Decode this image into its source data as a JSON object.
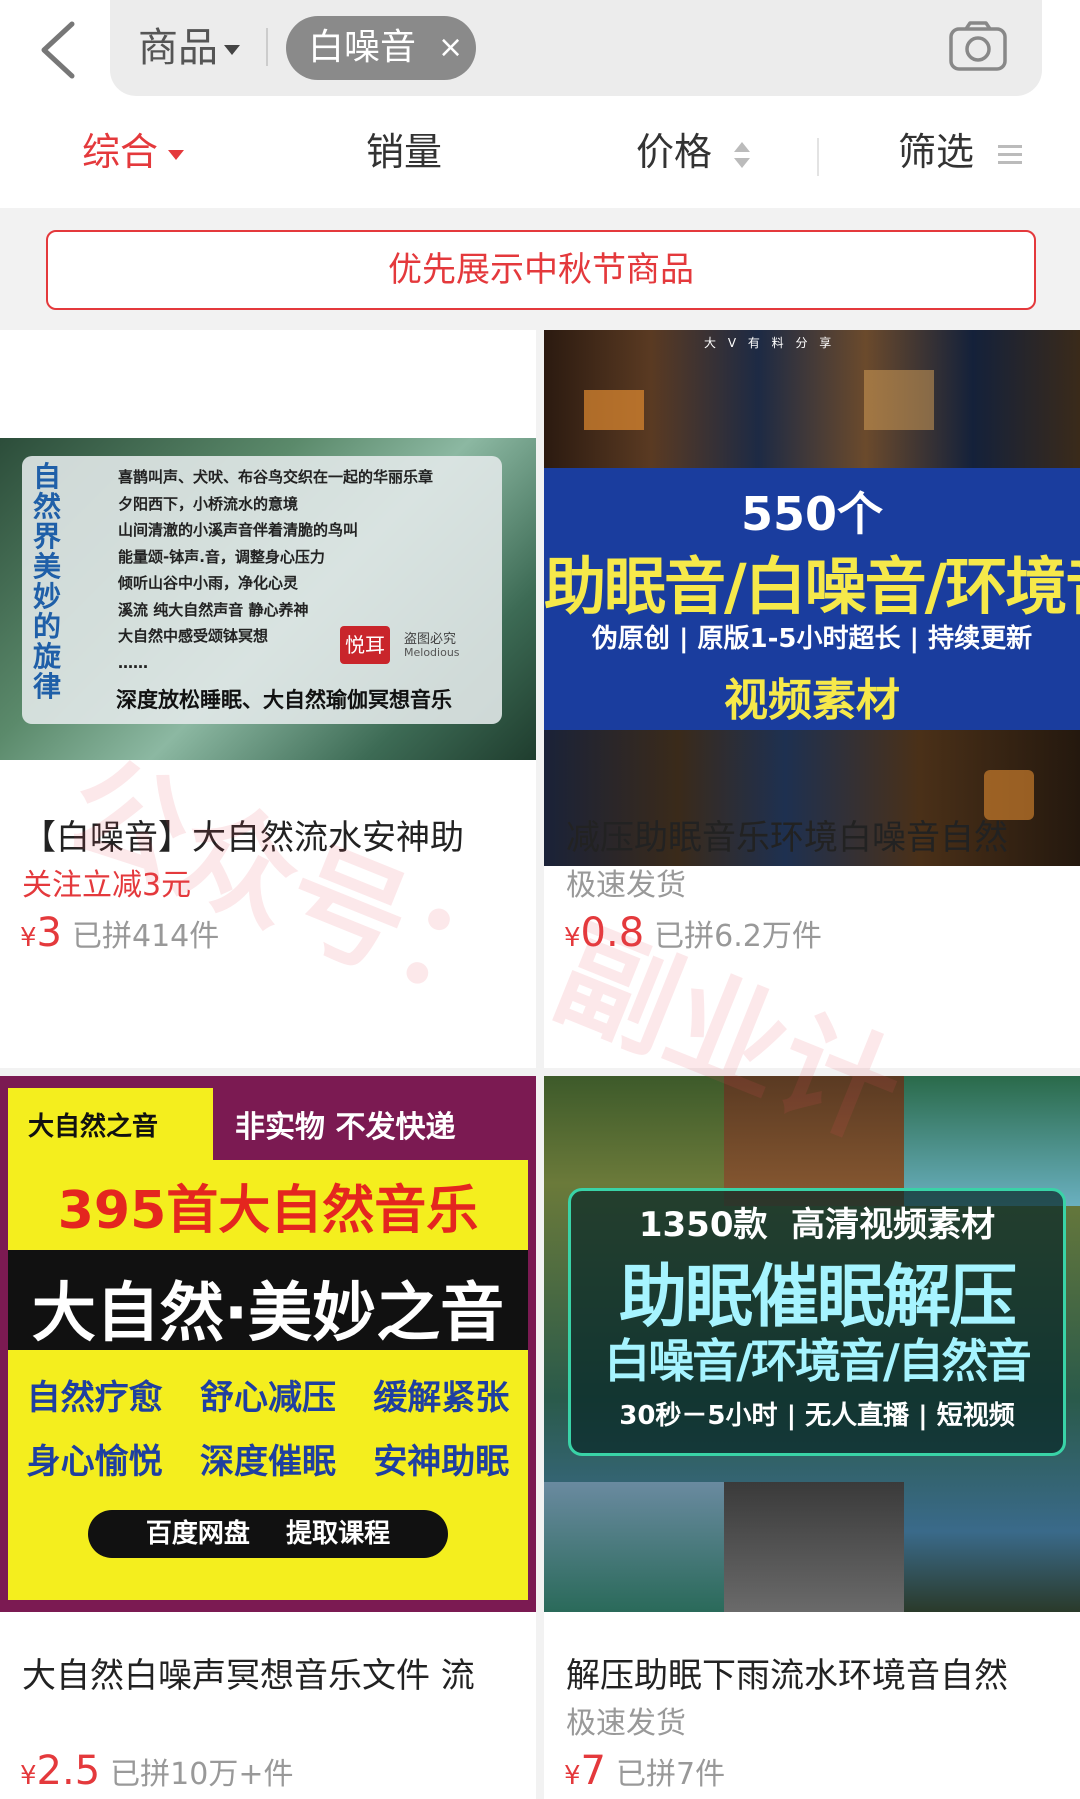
{
  "search": {
    "scope_label": "商品",
    "keyword_chip": "白噪音",
    "chip_close": "×"
  },
  "sort": {
    "comprehensive": "综合",
    "sales": "销量",
    "price": "价格",
    "filter": "筛选"
  },
  "promo_banner": "优先展示中秋节商品",
  "watermark": [
    "公众号：",
    "副业计"
  ],
  "colors": {
    "accent": "#e4393c",
    "muted": "#999999"
  },
  "products": [
    {
      "title": "【白噪音】大自然流水安神助",
      "tag": "关注立减3元",
      "price_symbol": "¥",
      "price": "3",
      "sold": "已拼414件",
      "image": {
        "vertical_title": "自然界美妙的旋律",
        "lines": [
          "喜鹊叫声、犬吠、布谷鸟交织在一起的华丽乐章",
          "夕阳西下，小桥流水的意境",
          "山间清澈的小溪声音伴着清脆的鸟叫",
          "能量颂-钵声.音，调整身心压力",
          "倾听山谷中小雨，净化心灵",
          "溪流  纯大自然声音 静心养神",
          "大自然中感受颂钵冥想",
          "……"
        ],
        "bottom": "深度放松睡眠、大自然瑜伽冥想音乐",
        "seal": "悦耳",
        "seal_note": "盗图必究",
        "seal_en": "Melodious"
      }
    },
    {
      "title": "减压助眠音乐环境白噪音自然",
      "tag": "极速发货",
      "price_symbol": "¥",
      "price": "0.8",
      "sold": "已拼6.2万件",
      "image": {
        "count": "550个",
        "headline": "助眠音/白噪音/环境音",
        "sub": "伪原创 | 原版1-5小时超长 | 持续更新",
        "footer": "视频素材",
        "credit": "大 V 有 料 分 享"
      }
    },
    {
      "title": "大自然白噪声冥想音乐文件 流",
      "tag": "",
      "price_symbol": "¥",
      "price": "2.5",
      "sold": "已拼10万+件",
      "image": {
        "corner": "大自然之音",
        "notice": "非实物  不发快递",
        "count_line": "395首大自然音乐",
        "headline": "大自然·美妙之音",
        "row1": [
          "自然疗愈",
          "舒心减压",
          "缓解紧张"
        ],
        "row2": [
          "身心愉悦",
          "深度催眠",
          "安神助眠"
        ],
        "pill": "百度网盘    提取课程"
      }
    },
    {
      "title": "解压助眠下雨流水环境音自然",
      "tag": "极速发货",
      "price_symbol": "¥",
      "price": "7",
      "sold": "已拼7件",
      "image": {
        "top": "1350款  高清视频素材",
        "headline1": "助眠催眠解压",
        "headline2": "白噪音/环境音/自然音",
        "sub": "30秒－5小时 | 无人直播 | 短视频"
      }
    }
  ]
}
